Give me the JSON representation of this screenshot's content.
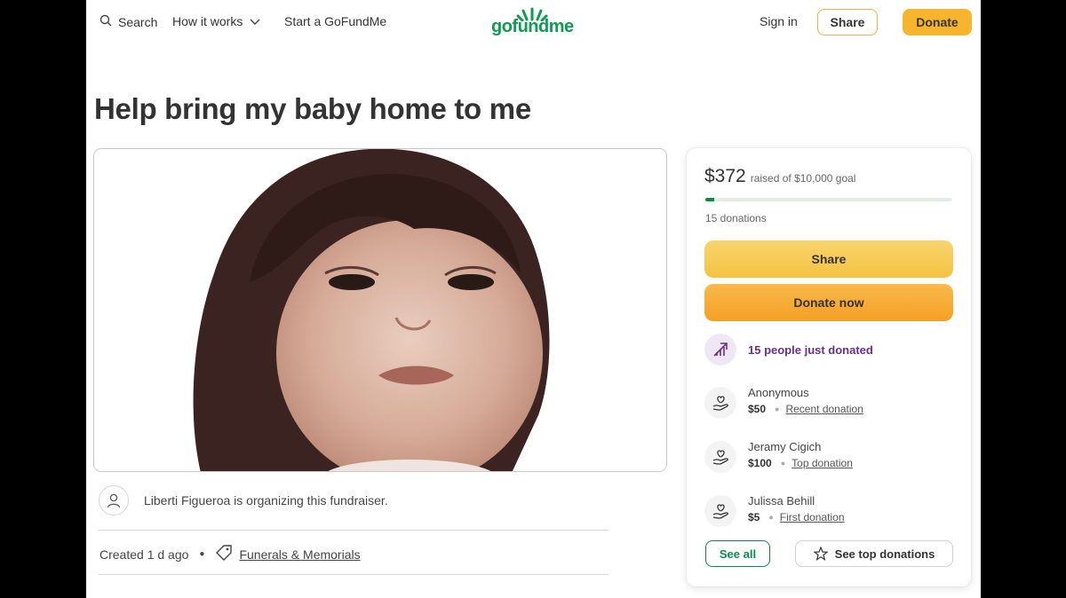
{
  "nav": {
    "search_label": "Search",
    "how_label": "How it works",
    "start_label": "Start a GoFundMe",
    "logo_text": "gofundme",
    "signin_label": "Sign in",
    "share_label": "Share",
    "donate_label": "Donate"
  },
  "campaign": {
    "title": "Help bring my baby home to me",
    "photo_alt": "Campaign photo",
    "organizer_text": "Liberti Figueroa is organizing this fundraiser.",
    "created": "Created 1 d ago",
    "category": "Funerals & Memorials"
  },
  "donation_card": {
    "raised": "$372",
    "goal_text": "raised of $10,000 goal",
    "progress_fraction": 0.0372,
    "donations_count": "15 donations",
    "share_label": "Share",
    "donate_now_label": "Donate now",
    "trend_text": "15 people just donated",
    "donors": [
      {
        "name": "Anonymous",
        "amount": "$50",
        "type": "Recent donation"
      },
      {
        "name": "Jeramy Cigich",
        "amount": "$100",
        "type": "Top donation"
      },
      {
        "name": "Julissa Behill",
        "amount": "$5",
        "type": "First donation"
      }
    ],
    "see_all_label": "See all",
    "see_top_label": "See top donations"
  },
  "colors": {
    "brand_green": "#0c8a4c",
    "accent_yellow": "#f7b52d",
    "accent_orange": "#f59f25",
    "trend_purple": "#6a2d8f"
  }
}
